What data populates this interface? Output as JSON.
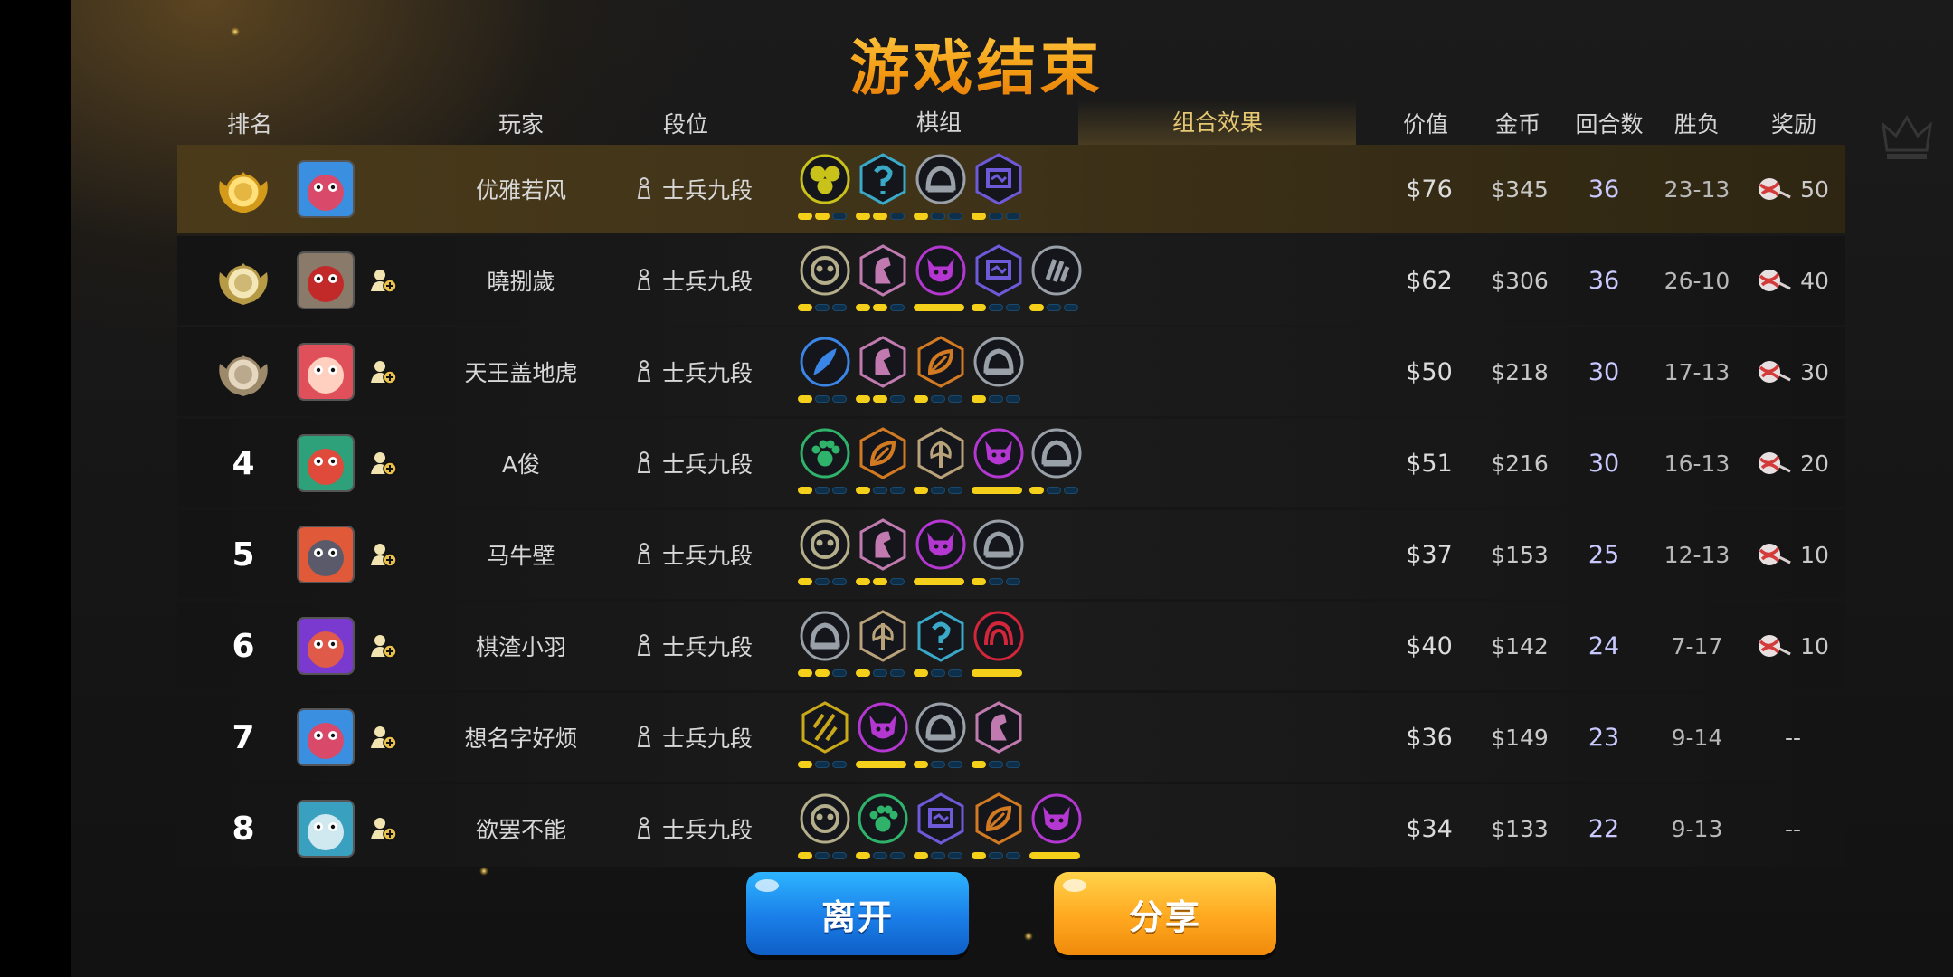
{
  "title": "游戏结束",
  "headers": {
    "rank": "排名",
    "player": "玩家",
    "tier": "段位",
    "pieces": "棋组",
    "combo": "组合效果",
    "value": "价值",
    "gold": "金币",
    "rounds": "回合数",
    "winloss": "胜负",
    "reward": "奖励"
  },
  "colors": {
    "title": "#f6a21c",
    "rounds": "#c9c9ff",
    "bar_on": "#f5d01a",
    "leave_button": "#1a7ee8",
    "share_button": "#ffa81f"
  },
  "rows": [
    {
      "rank": "1",
      "rank_display": "gold-medal",
      "player": "优雅若风",
      "tier": "士兵九段",
      "value": "$76",
      "gold": "$345",
      "rounds": "36",
      "winloss": "23-13",
      "reward": "50",
      "avatar": "blue-bird-avatar",
      "add_friend": false,
      "synergies": [
        {
          "icon": "trio-icon",
          "color": "#c9c21a",
          "bars": [
            1,
            1,
            0
          ]
        },
        {
          "icon": "rune-icon",
          "color": "#39a9c7",
          "bars": [
            1,
            1,
            0
          ]
        },
        {
          "icon": "pod-icon",
          "color": "#9aa0a8",
          "bars": [
            1,
            0,
            0
          ]
        },
        {
          "icon": "mech-icon",
          "color": "#6e59d8",
          "bars": [
            1,
            0,
            0
          ]
        }
      ]
    },
    {
      "rank": "2",
      "rank_display": "silver-medal",
      "player": "曉捌歲",
      "tier": "士兵九段",
      "value": "$62",
      "gold": "$306",
      "rounds": "36",
      "winloss": "26-10",
      "reward": "40",
      "avatar": "ninja-avatar",
      "add_friend": true,
      "synergies": [
        {
          "icon": "paw-face-icon",
          "color": "#b5ae8a",
          "bars": [
            1,
            0,
            0
          ]
        },
        {
          "icon": "knight-icon",
          "color": "#c07ab0",
          "bars": [
            1,
            1,
            0
          ]
        },
        {
          "icon": "demon-icon",
          "color": "#b437d1",
          "bars": [
            1,
            0,
            0
          ]
        },
        {
          "icon": "mech-icon",
          "color": "#6e59d8",
          "bars": [
            1,
            0,
            0
          ]
        },
        {
          "icon": "claw-icon",
          "color": "#9aa0a8",
          "bars": [
            1,
            0,
            0
          ]
        }
      ]
    },
    {
      "rank": "3",
      "rank_display": "bronze-medal",
      "player": "天王盖地虎",
      "tier": "士兵九段",
      "value": "$50",
      "gold": "$218",
      "rounds": "30",
      "winloss": "17-13",
      "reward": "30",
      "avatar": "red-dragon-avatar",
      "add_friend": true,
      "synergies": [
        {
          "icon": "feather-icon",
          "color": "#3a86e6",
          "bars": [
            1,
            0,
            0
          ]
        },
        {
          "icon": "knight-icon",
          "color": "#c07ab0",
          "bars": [
            1,
            1,
            0
          ]
        },
        {
          "icon": "leaf-icon",
          "color": "#d27a22",
          "bars": [
            1,
            0,
            0
          ]
        },
        {
          "icon": "pod-icon",
          "color": "#9aa0a8",
          "bars": [
            1,
            0,
            0
          ]
        }
      ]
    },
    {
      "rank": "4",
      "rank_display": "number",
      "player": "A俊",
      "tier": "士兵九段",
      "value": "$51",
      "gold": "$216",
      "rounds": "30",
      "winloss": "16-13",
      "reward": "20",
      "avatar": "dino-avatar",
      "add_friend": true,
      "synergies": [
        {
          "icon": "paw-icon",
          "color": "#2fb36b",
          "bars": [
            1,
            0,
            0
          ]
        },
        {
          "icon": "leaf-icon",
          "color": "#d27a22",
          "bars": [
            1,
            0,
            0
          ]
        },
        {
          "icon": "axe-icon",
          "color": "#b9a27a",
          "bars": [
            1,
            0,
            0
          ]
        },
        {
          "icon": "demon-icon",
          "color": "#b437d1",
          "bars": [
            1,
            0,
            0
          ]
        },
        {
          "icon": "pod-icon",
          "color": "#9aa0a8",
          "bars": [
            1,
            0,
            0
          ]
        }
      ]
    },
    {
      "rank": "5",
      "rank_display": "number",
      "player": "马牛壁",
      "tier": "士兵九段",
      "value": "$37",
      "gold": "$153",
      "rounds": "25",
      "winloss": "12-13",
      "reward": "10",
      "avatar": "wolf-avatar",
      "add_friend": true,
      "synergies": [
        {
          "icon": "paw-face-icon",
          "color": "#b5ae8a",
          "bars": [
            1,
            0,
            0
          ]
        },
        {
          "icon": "knight-icon",
          "color": "#c07ab0",
          "bars": [
            1,
            1,
            0
          ]
        },
        {
          "icon": "demon-icon",
          "color": "#b437d1",
          "bars": [
            1,
            0,
            0
          ]
        },
        {
          "icon": "pod-icon",
          "color": "#9aa0a8",
          "bars": [
            1,
            0,
            0
          ]
        }
      ]
    },
    {
      "rank": "6",
      "rank_display": "number",
      "player": "棋渣小羽",
      "tier": "士兵九段",
      "value": "$40",
      "gold": "$142",
      "rounds": "24",
      "winloss": "7-17",
      "reward": "10",
      "avatar": "pirate-avatar",
      "add_friend": true,
      "synergies": [
        {
          "icon": "pod-icon",
          "color": "#9aa0a8",
          "bars": [
            1,
            1,
            0
          ]
        },
        {
          "icon": "axe-icon",
          "color": "#b9a27a",
          "bars": [
            1,
            0,
            0
          ]
        },
        {
          "icon": "rune-icon",
          "color": "#39a9c7",
          "bars": [
            1,
            0,
            0
          ]
        },
        {
          "icon": "arch-icon",
          "color": "#d3263a",
          "bars": [
            1,
            0,
            0
          ]
        }
      ]
    },
    {
      "rank": "7",
      "rank_display": "number",
      "player": "想名字好烦",
      "tier": "士兵九段",
      "value": "$36",
      "gold": "$149",
      "rounds": "23",
      "winloss": "9-14",
      "reward": "--",
      "avatar": "blue-bird-avatar",
      "add_friend": true,
      "synergies": [
        {
          "icon": "trident-icon",
          "color": "#c9a91a",
          "bars": [
            1,
            0,
            0
          ]
        },
        {
          "icon": "demon-icon",
          "color": "#b437d1",
          "bars": [
            1,
            0,
            0
          ]
        },
        {
          "icon": "pod-icon",
          "color": "#9aa0a8",
          "bars": [
            1,
            0,
            0
          ]
        },
        {
          "icon": "knight-icon",
          "color": "#c07ab0",
          "bars": [
            1,
            0,
            0
          ]
        }
      ]
    },
    {
      "rank": "8",
      "rank_display": "number",
      "player": "欲罢不能",
      "tier": "士兵九段",
      "value": "$34",
      "gold": "$133",
      "rounds": "22",
      "winloss": "9-13",
      "reward": "--",
      "avatar": "blue-beast-avatar",
      "add_friend": true,
      "synergies": [
        {
          "icon": "paw-face-icon",
          "color": "#b5ae8a",
          "bars": [
            1,
            0,
            0
          ]
        },
        {
          "icon": "paw-icon",
          "color": "#2fb36b",
          "bars": [
            1,
            0,
            0
          ]
        },
        {
          "icon": "mech-icon",
          "color": "#6e59d8",
          "bars": [
            1,
            0,
            0
          ]
        },
        {
          "icon": "leaf-icon",
          "color": "#d27a22",
          "bars": [
            1,
            0,
            0
          ]
        },
        {
          "icon": "demon-icon",
          "color": "#b437d1",
          "bars": [
            1,
            0,
            0
          ]
        }
      ]
    }
  ],
  "buttons": {
    "leave": "离开",
    "share": "分享"
  }
}
